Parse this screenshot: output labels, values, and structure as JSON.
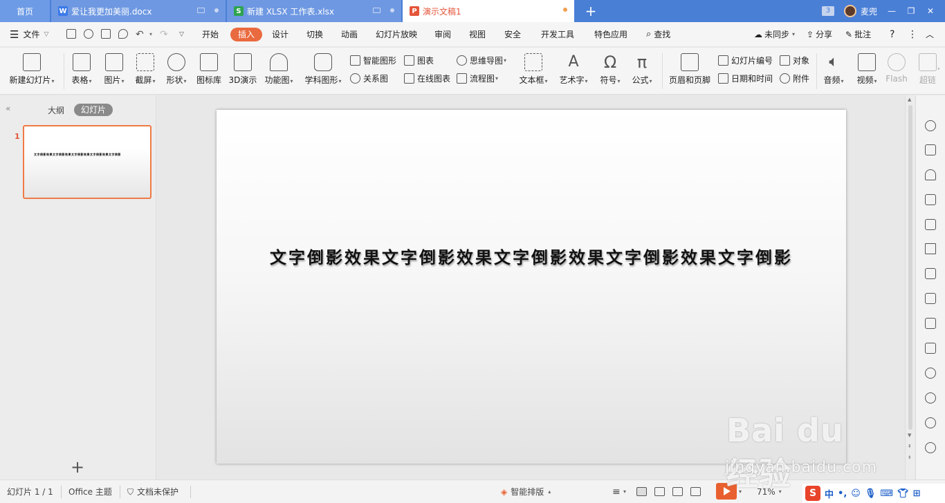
{
  "tabs": {
    "home": "首页",
    "doc1": {
      "name": "爱让我更加美丽.docx",
      "icon": "W",
      "color": "#3b7ae8"
    },
    "doc2": {
      "name": "新建 XLSX 工作表.xlsx",
      "icon": "S",
      "color": "#2ea44f"
    },
    "doc3": {
      "name": "演示文稿1",
      "icon": "P",
      "color": "#e4553a"
    },
    "new_tab": "+",
    "window_count": "3",
    "user": "麦兜"
  },
  "menu": {
    "file": "文件",
    "items": [
      "开始",
      "插入",
      "设计",
      "切换",
      "动画",
      "幻灯片放映",
      "审阅",
      "视图",
      "安全",
      "开发工具",
      "特色应用"
    ],
    "active": "插入",
    "search": "查找",
    "sync": "未同步",
    "share": "分享",
    "comment": "批注",
    "help": "?"
  },
  "ribbon": {
    "new_slide": "新建幻灯片",
    "table": "表格",
    "picture": "图片",
    "screenshot": "截屏",
    "shape": "形状",
    "icon_lib": "图标库",
    "three_d": "3D演示",
    "func_chart": "功能图",
    "subject_shape": "学科图形",
    "smart_shape": "智能图形",
    "relation": "关系图",
    "chart": "图表",
    "online_chart": "在线图表",
    "mindmap": "思维导图",
    "flowchart": "流程图",
    "textbox": "文本框",
    "wordart": "艺术字",
    "symbol": "符号",
    "formula": "公式",
    "header_footer": "页眉和页脚",
    "slide_number": "幻灯片编号",
    "datetime": "日期和时间",
    "object": "对象",
    "attachment": "附件",
    "audio": "音频",
    "video": "视频",
    "flash": "Flash",
    "hyperlink": "超链"
  },
  "left_panel": {
    "outline_tab": "大纲",
    "slides_tab": "幻灯片",
    "slide_number": "1",
    "add_slide": "+"
  },
  "slide": {
    "text": "文字倒影效果文字倒影效果文字倒影效果文字倒影效果文字倒影"
  },
  "status": {
    "slide_info": "幻灯片 1 / 1",
    "theme": "Office 主题",
    "protection": "文档未保护",
    "smart_layout": "智能排版",
    "zoom": "71%"
  },
  "watermark": {
    "logo": "Bai du 经验",
    "url": "jingyan.baidu.com"
  },
  "tray": {
    "ime": "S",
    "lang": "中"
  }
}
